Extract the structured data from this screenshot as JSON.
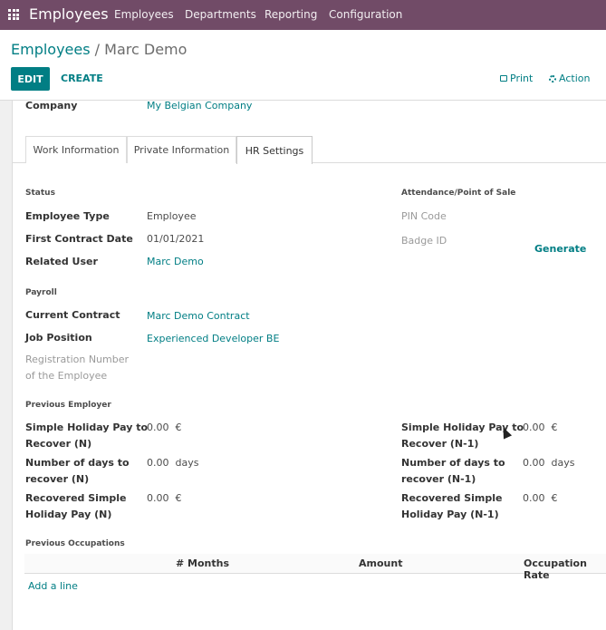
{
  "navbar": {
    "app_title": "Employees",
    "menu": [
      "Employees",
      "Departments",
      "Reporting",
      "Configuration"
    ],
    "bg_color": "#714b67"
  },
  "breadcrumb": {
    "parent": "Employees",
    "separator": "/",
    "current": "Marc Demo"
  },
  "toolbar": {
    "edit_label": "EDIT",
    "create_label": "CREATE",
    "print_label": "Print",
    "action_label": "Action",
    "accent_color": "#017e84"
  },
  "company": {
    "label": "Company",
    "value": "My Belgian Company"
  },
  "tabs": [
    "Work Information",
    "Private Information",
    "HR Settings"
  ],
  "active_tab": "HR Settings",
  "status": {
    "title": "Status",
    "employee_type": {
      "label": "Employee Type",
      "value": "Employee"
    },
    "first_contract_date": {
      "label": "First Contract Date",
      "value": "01/01/2021"
    },
    "related_user": {
      "label": "Related User",
      "value": "Marc Demo"
    }
  },
  "attendance": {
    "title": "Attendance/Point of Sale",
    "pin_code_label": "PIN Code",
    "badge_id_label": "Badge ID",
    "generate_label": "Generate"
  },
  "payroll": {
    "title": "Payroll",
    "current_contract": {
      "label": "Current Contract",
      "value": "Marc Demo Contract"
    },
    "job_position": {
      "label": "Job Position",
      "value": "Experienced Developer BE"
    },
    "registration_number": {
      "label_line1": "Registration Number",
      "label_line2": "of the Employee"
    }
  },
  "previous_employer": {
    "title": "Previous Employer",
    "left": [
      {
        "line1": "Simple Holiday Pay to",
        "line2": "Recover (N)",
        "amount": "0.00",
        "unit": "€"
      },
      {
        "line1": "Number of days to",
        "line2": "recover (N)",
        "amount": "0.00",
        "unit": "days"
      },
      {
        "line1": "Recovered Simple",
        "line2": "Holiday Pay (N)",
        "amount": "0.00",
        "unit": "€"
      }
    ],
    "right": [
      {
        "line1": "Simple Holiday Pay to",
        "line2": "Recover (N-1)",
        "amount": "0.00",
        "unit": "€"
      },
      {
        "line1": "Number of days to",
        "line2": "recover (N-1)",
        "amount": "0.00",
        "unit": "days"
      },
      {
        "line1": "Recovered Simple",
        "line2": "Holiday Pay (N-1)",
        "amount": "0.00",
        "unit": "€"
      }
    ]
  },
  "previous_occupations": {
    "title": "Previous Occupations",
    "columns": [
      "# Months",
      "Amount",
      "Occupation Rate"
    ],
    "add_line_label": "Add a line"
  }
}
